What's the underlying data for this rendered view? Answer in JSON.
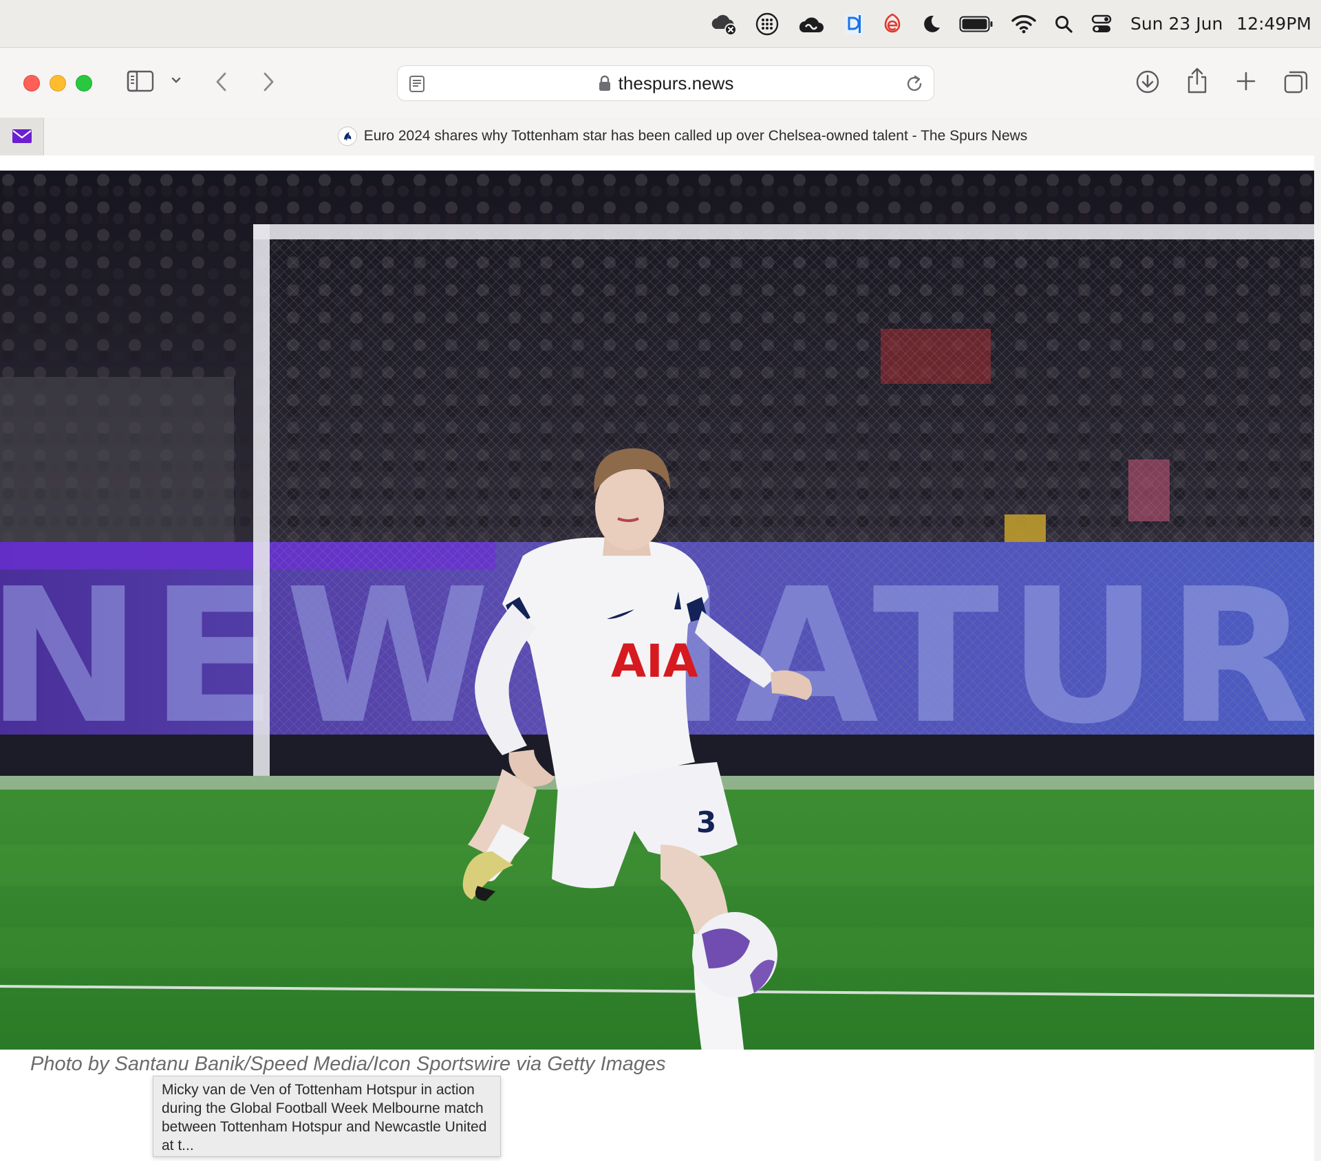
{
  "menubar": {
    "icons": [
      "icloud-error-icon",
      "launchpad-icon",
      "creative-cloud-icon",
      "dashlane-icon",
      "app-e-icon",
      "focus-moon-icon",
      "battery-icon",
      "wifi-icon",
      "spotlight-search-icon",
      "control-center-icon"
    ],
    "date": "Sun 23 Jun",
    "time": "12:49PM"
  },
  "browser": {
    "url": "thespurs.news",
    "tab_title": "Euro 2024 shares why Tottenham star has been called up over Chelsea-owned talent - The Spurs News"
  },
  "article": {
    "photo_credit": "Photo by Santanu Banik/Speed Media/Icon Sportswire via Getty Images",
    "photo_tooltip": "Micky van de Ven of Tottenham Hotspur in action during the Global Football Week Melbourne match between Tottenham Hotspur and Newcastle United at t...",
    "shirt_sponsor": "AIA",
    "board_text": "NEW NATURE"
  },
  "colors": {
    "accent_red": "#d71920",
    "spurs_navy": "#132257",
    "pitch_green": "#2f8a2c"
  }
}
